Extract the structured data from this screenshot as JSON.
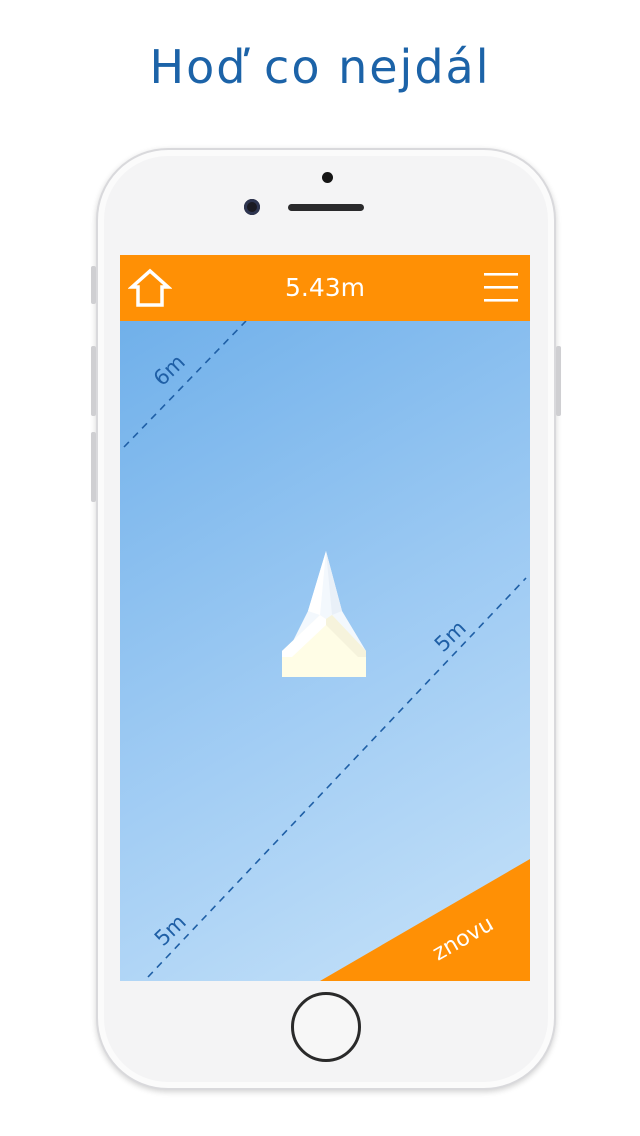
{
  "headline": "Hoď co nejdál",
  "topbar": {
    "distance": "5.43m",
    "home_icon": "home-outline-icon",
    "menu_icon": "hamburger-menu-icon"
  },
  "field": {
    "line_labels": [
      "6m",
      "5m",
      "5m"
    ],
    "plane_icon": "paper-airplane-icon"
  },
  "retry_button": {
    "label": "znovu"
  },
  "colors": {
    "accent": "#ff9005",
    "headline": "#1c63a8",
    "sky_top": "#70b0ea",
    "sky_bottom": "#c6e2f9",
    "line": "#1f5fa6"
  }
}
